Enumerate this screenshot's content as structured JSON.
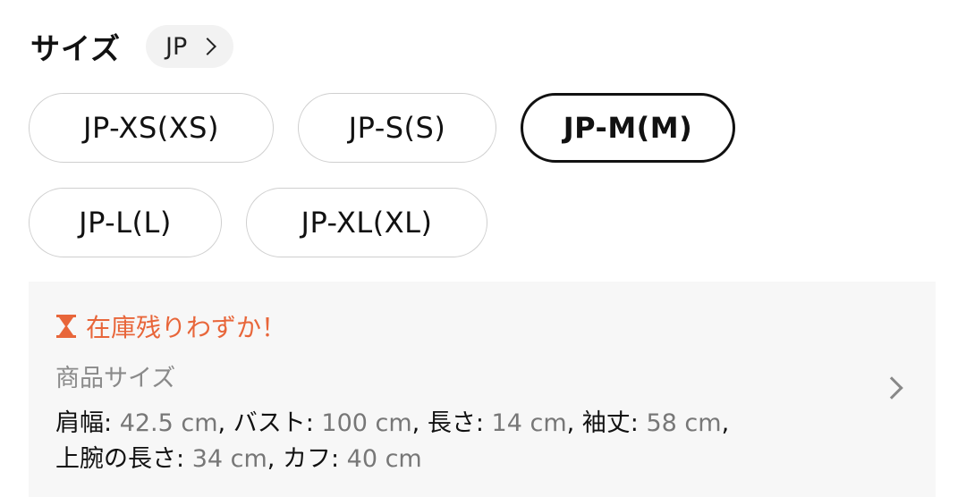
{
  "header": {
    "title": "サイズ",
    "region": "JP"
  },
  "sizes": [
    {
      "label": "JP-XS(XS)",
      "selected": false
    },
    {
      "label": "JP-S(S)",
      "selected": false
    },
    {
      "label": "JP-M(M)",
      "selected": true
    },
    {
      "label": "JP-L(L)",
      "selected": false
    },
    {
      "label": "JP-XL(XL)",
      "selected": false
    }
  ],
  "info": {
    "stock_alert": "在庫残りわずか！",
    "section_label": "商品サイズ",
    "measurements": [
      {
        "label": "肩幅",
        "value": "42.5 cm"
      },
      {
        "label": "バスト",
        "value": "100 cm"
      },
      {
        "label": "長さ",
        "value": "14 cm"
      },
      {
        "label": "袖丈",
        "value": "58 cm"
      },
      {
        "label": "上腕の長さ",
        "value": "34 cm"
      },
      {
        "label": "カフ",
        "value": "40 cm"
      }
    ],
    "colors": {
      "alert": "#e8663a",
      "panel": "#f7f7f7"
    }
  }
}
